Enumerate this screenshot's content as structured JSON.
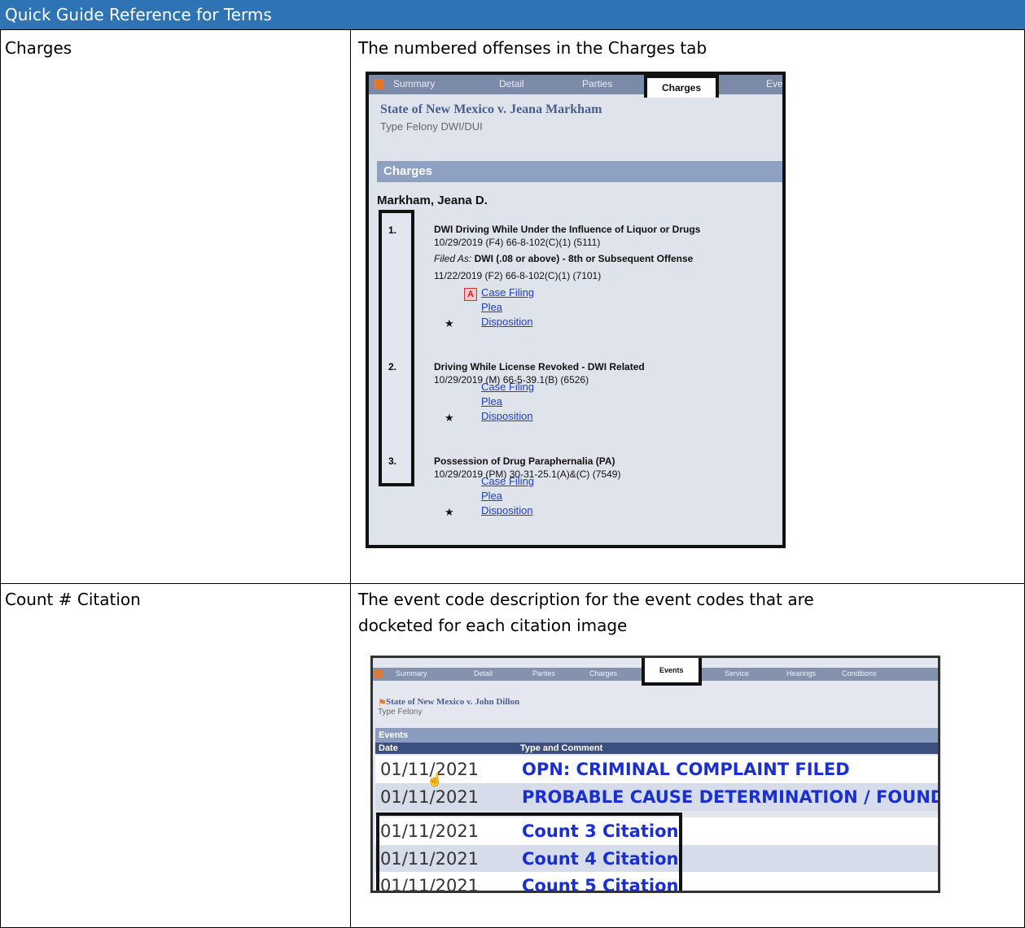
{
  "header": {
    "title": "Quick Guide Reference for Terms"
  },
  "rows": [
    {
      "term": "Charges",
      "definition": "The numbered offenses in the Charges tab"
    },
    {
      "term": "Count # Citation",
      "definition_line1": "The event code description for the event codes that are",
      "definition_line2": "docketed for each citation image"
    }
  ],
  "shot1": {
    "tabs": [
      "Summary",
      "Detail",
      "Parties",
      "Charges",
      "Eve"
    ],
    "active_tab": "Charges",
    "case_title": "State of New Mexico v. Jeana Markham",
    "type_label": "Type",
    "type_value": "Felony DWI/DUI",
    "section": "Charges",
    "party": "Markham, Jeana D.",
    "charges": [
      {
        "num": "1.",
        "title": "DWI Driving While Under the Influence of Liquor or Drugs",
        "detail": "10/29/2019  (F4)  66-8-102(C)(1)  (5111)",
        "filed_as_label": "Filed As:",
        "filed_as": "DWI (.08 or above) - 8th or Subsequent Offense",
        "filed_detail": "11/22/2019  (F2)  66-8-102(C)(1)  (7101)",
        "links": [
          "Case Filing",
          "Plea",
          "Disposition"
        ]
      },
      {
        "num": "2.",
        "title": "Driving While License Revoked - DWI Related",
        "detail": "10/29/2019  (M)  66-5-39.1(B)  (6526)",
        "links": [
          "Case Filing",
          "Plea",
          "Disposition"
        ]
      },
      {
        "num": "3.",
        "title": "Possession of Drug Paraphernalia (PA)",
        "detail": "10/29/2019  (PM)  30-31-25.1(A)&(C)  (7549)",
        "links": [
          "Case Filing",
          "Plea",
          "Disposition"
        ]
      }
    ]
  },
  "shot2": {
    "tabs": [
      "Summary",
      "Detail",
      "Parties",
      "Charges",
      "Events",
      "Service",
      "Hearings",
      "Conditions"
    ],
    "active_tab": "Events",
    "case_title": "State of New Mexico v. John Dillon",
    "type_label": "Type",
    "type_value": "Felony",
    "section": "Events",
    "col_date": "Date",
    "col_type": "Type and Comment",
    "events": [
      {
        "date": "01/11/2021",
        "desc": "OPN: CRIMINAL COMPLAINT FILED"
      },
      {
        "date": "01/11/2021",
        "desc": "PROBABLE CAUSE DETERMINATION / FOUND"
      },
      {
        "date": "01/11/2021",
        "desc": "Count 3 Citation"
      },
      {
        "date": "01/11/2021",
        "desc": "Count 4 Citation"
      },
      {
        "date": "01/11/2021",
        "desc": "Count 5 Citation"
      }
    ]
  },
  "colors": {
    "header_bg": "#2e74b5",
    "link": "#1f3ec8",
    "event_text": "#1a2fd0"
  }
}
